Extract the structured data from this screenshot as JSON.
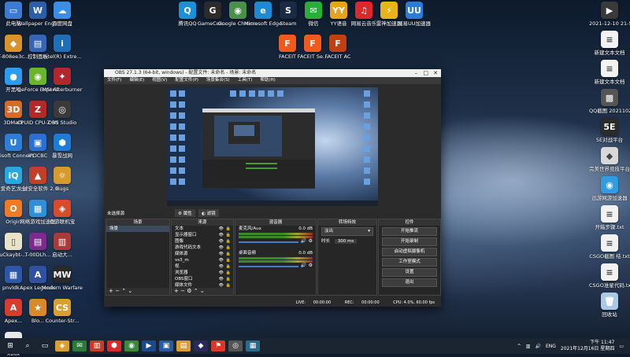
{
  "desktop_icons_left": [
    {
      "label": "此电脑",
      "color": "#3b7bd1",
      "glyph": "▭"
    },
    {
      "label": "Wallpaper Engine: ...",
      "color": "#2b5ea8",
      "glyph": "W"
    },
    {
      "label": "百度网盘",
      "color": "#3a8ee6",
      "glyph": "☁"
    },
    {
      "label": "T-808ee3c...",
      "color": "#d8932b",
      "glyph": "◆"
    },
    {
      "label": "控制面板",
      "color": "#3466b5",
      "glyph": "▤"
    },
    {
      "label": "Intel(R) Extre...",
      "color": "#1f6fb7",
      "glyph": "i"
    },
    {
      "label": "开黑啦",
      "color": "#2c9cf0",
      "glyph": "●"
    },
    {
      "label": "GeForce Experience",
      "color": "#6bb52a",
      "glyph": "◉"
    },
    {
      "label": "MSI Afterburner",
      "color": "#b0282b",
      "glyph": "✦"
    },
    {
      "label": "3DMark",
      "color": "#d46b28",
      "glyph": "3D"
    },
    {
      "label": "CPUID CPU-Z MSI",
      "color": "#b02a2a",
      "glyph": "Z"
    },
    {
      "label": "OBS Studio",
      "color": "#3a3a3a",
      "glyph": "◎"
    },
    {
      "label": "Ubisoft Connect",
      "color": "#2d7ed6",
      "glyph": "U"
    },
    {
      "label": "IPDCBC",
      "color": "#2a6fd1",
      "glyph": "▣"
    },
    {
      "label": "暴雪战网",
      "color": "#1e7cd8",
      "glyph": "⬢"
    },
    {
      "label": "爱奇艺大全",
      "color": "#25a9e0",
      "glyph": "iQ"
    },
    {
      "label": "火绒安全软件 2.0",
      "color": "#c2402a",
      "glyph": "▲"
    },
    {
      "label": "Bugs",
      "color": "#d79b2d",
      "glyph": "☼"
    },
    {
      "label": "Origin",
      "color": "#f07b24",
      "glyph": "O"
    },
    {
      "label": "网络游戏加速器",
      "color": "#2f8fd8",
      "glyph": "▦"
    },
    {
      "label": "奇游联机宝",
      "color": "#d84c2b",
      "glyph": "◈"
    },
    {
      "label": "uCkaybt-...",
      "color": "#e8e2c8",
      "glyph": "▯"
    },
    {
      "label": "T-00DLh...",
      "color": "#7b2a8e",
      "glyph": "▤"
    },
    {
      "label": "启动大...",
      "color": "#a83a3a",
      "glyph": "▥"
    },
    {
      "label": "pnvldk...",
      "color": "#2d57a8",
      "glyph": "▦"
    },
    {
      "label": "Apex Legends",
      "color": "#3050a0",
      "glyph": "A"
    },
    {
      "label": "Modern Warfare...",
      "color": "#2a2a2a",
      "glyph": "MW"
    },
    {
      "label": "Apex...",
      "color": "#d83c2c",
      "glyph": "A"
    },
    {
      "label": "Blo...",
      "color": "#d88a2a",
      "glyph": "★"
    },
    {
      "label": "Counter-Str...",
      "color": "#d8a030",
      "glyph": "CS"
    },
    {
      "label": "Xbox",
      "color": "#e8e8e8",
      "glyph": "✕"
    }
  ],
  "desktop_icons_top": [
    {
      "label": "腾讯QQ",
      "color": "#1b8fd8",
      "glyph": "Q"
    },
    {
      "label": "GameCen...",
      "color": "#2b2b2b",
      "glyph": "G"
    },
    {
      "label": "Google Chrome",
      "color": "#4a8f4a",
      "glyph": "◉"
    },
    {
      "label": "Microsoft Edge",
      "color": "#1f8ad4",
      "glyph": "e"
    },
    {
      "label": "Steam",
      "color": "#1b2a44",
      "glyph": "S"
    },
    {
      "label": "微信",
      "color": "#2aae3a",
      "glyph": "✉"
    },
    {
      "label": "YY语音",
      "color": "#e8a21c",
      "glyph": "YY"
    },
    {
      "label": "网易云音乐",
      "color": "#d82a2a",
      "glyph": "♫"
    },
    {
      "label": "雷神加速器",
      "color": "#e8b41c",
      "glyph": "⚡"
    },
    {
      "label": "网易UU加速器",
      "color": "#2b7bd8",
      "glyph": "UU"
    }
  ],
  "desktop_icons_faceit": [
    {
      "label": "FACEIT",
      "color": "#f05a1c",
      "glyph": "F"
    },
    {
      "label": "FACEIT Se...",
      "color": "#f05a1c",
      "glyph": "F"
    },
    {
      "label": "FACEIT AC",
      "color": "#c04014",
      "glyph": "F"
    }
  ],
  "desktop_icons_right": [
    {
      "label": "2021-12-10 21-52-17...",
      "color": "#3a3a3a",
      "glyph": "▶"
    },
    {
      "label": "新建文本文档",
      "color": "#f2f2f2",
      "glyph": "≡"
    },
    {
      "label": "新建文本文档",
      "color": "#f2f2f2",
      "glyph": "≡"
    },
    {
      "label": "QQ截图 2021102...",
      "color": "#555",
      "glyph": "▩"
    },
    {
      "label": "5E对战平台",
      "color": "#2b2b2b",
      "glyph": "5E"
    },
    {
      "label": "完美世界竞技平台",
      "color": "#d8d8d8",
      "glyph": "◆"
    },
    {
      "label": "迅游网游加速器",
      "color": "#2f9de0",
      "glyph": "◉"
    },
    {
      "label": "开箱步骤.txt",
      "color": "#f2f2f2",
      "glyph": "≡"
    },
    {
      "label": "CSGO截图 结.txt",
      "color": "#f2f2f2",
      "glyph": "≡"
    },
    {
      "label": "CSGO准星代码.txt",
      "color": "#f2f2f2",
      "glyph": "≡"
    },
    {
      "label": "回收站",
      "color": "#aac8e8",
      "glyph": "🗑"
    }
  ],
  "obs": {
    "window_title": "OBS 27.1.3 (64-bit, windows) - 配置文件: 未命名 - 场景: 未命名",
    "menu": [
      "文件(F)",
      "编辑(E)",
      "视图(V)",
      "配置文件(P)",
      "场景集合(S)",
      "工具(T)",
      "帮助(H)"
    ],
    "mode_label": "未选择源",
    "btn_properties": "属性",
    "btn_filters": "滤镜",
    "scenes_header": "场景",
    "scenes": [
      "场景"
    ],
    "sources_header": "来源",
    "sources": [
      "文本",
      "显示器窗口",
      "图像",
      "游戏代码文本",
      "媒体源",
      "vs3_m",
      "视",
      "浏览器",
      "OBS窗口",
      "媒体文件"
    ],
    "mixer_header": "混音器",
    "mixer": [
      {
        "name": "麦克风/Aux",
        "db": "0.0 dB"
      },
      {
        "name": "桌面音频",
        "db": "0.0 dB"
      }
    ],
    "transitions_header": "转场特效",
    "transition_type": "淡出",
    "duration_label": "时长",
    "duration_value": "300 ms",
    "controls_header": "控件",
    "controls": [
      "开始推流",
      "开始录制",
      "启动虚拟摄像机",
      "工作室模式",
      "设置",
      "退出"
    ],
    "status": {
      "live_label": "LIVE:",
      "live_time": "00:00:00",
      "rec_label": "REC:",
      "rec_time": "00:00:00",
      "cpu": "CPU: 4.0%, 60.00 fps"
    }
  },
  "taskbar": {
    "apps": [
      "start",
      "search",
      "taskview",
      "app1",
      "app2",
      "app3",
      "app4",
      "app5",
      "app6",
      "app7",
      "app8",
      "app9",
      "app10",
      "app11",
      "app12"
    ],
    "lang": "ENG",
    "time": "下午 11:47",
    "date": "2021年12月16日 星期四"
  }
}
